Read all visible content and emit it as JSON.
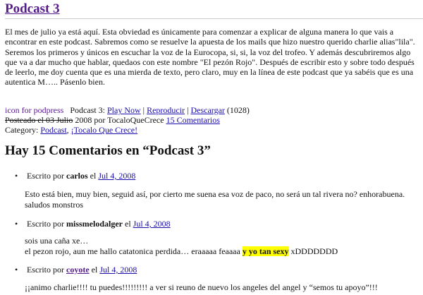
{
  "post": {
    "title": "Podcast 3",
    "intro": "El mes de julio ya está aquí. Esta obviedad es únicamente para comenzar a explicar de alguna manera lo que vais a encontrar en este podcast. Sabremos como se resuelve la apuesta de los mails que hizo nuestro querido charlie alias\"lila\". Seremos los primeros y únicos en escuchar la voz de la Eurocopa, si, si, la voz del trofeo. Y además descubriremos algo que va a dar mucho que hablar, quedaos con este nombre \"El pezón Rojo\". Después de escribir esto y sobre todo después de leerlo, me doy cuenta que es una mierda de texto, pero claro, muy en la línea de este podcast que ya sabéis que es una autentica M….. Pásenlo bien."
  },
  "player": {
    "icon_alt": "icon for podpress",
    "label": "Podcast 3:",
    "play_now": "Play Now",
    "sep1": "|",
    "play": "Reproducir",
    "sep2": "|",
    "download": "Descargar",
    "download_count": "(1028)"
  },
  "meta": {
    "posted_strike": "Posteado el 03 Julio",
    "posted_rest": "2008 por TocaloQueCrece",
    "comments_link": "15 Comentarios",
    "category_label": "Category:",
    "category_1": "Podcast",
    "category_sep": ",",
    "category_2": "¡Tocalo Que Crece!"
  },
  "comments_heading": "Hay 15 Comentarios en “Podcast 3”",
  "comments": [
    {
      "written_by": "Escrito por",
      "author": "carlos",
      "on": "el",
      "date": "Jul 4, 2008",
      "text": "Esto está bien, muy bien, seguid así, por cierto me suena esa voz de paco, no será un tal rivera no? enhorabuena. saludos monstros"
    },
    {
      "written_by": "Escrito por",
      "author": "missmelodalger",
      "on": "el",
      "date": "Jul 4, 2008",
      "line1": "sois una caña xe…",
      "line2_pre": "el pezon rojo, aun me hallo catatonica perdida… eraaaaa feaaaa",
      "line2_hl": "y yo tan sexy",
      "line2_post": "xDDDDDDD"
    },
    {
      "written_by": "Escrito por",
      "author": "coyote",
      "on": "el",
      "date": "Jul 4, 2008",
      "text": "¡¡animo charlie!!!! tu puedes!!!!!!!!! a ver si reuno de nuevo los angeles del angel y “semos tu apoyo”!!!"
    }
  ],
  "colors": {
    "link": "#1a0dab",
    "visited": "#551a8b",
    "highlight": "#ffff00"
  }
}
